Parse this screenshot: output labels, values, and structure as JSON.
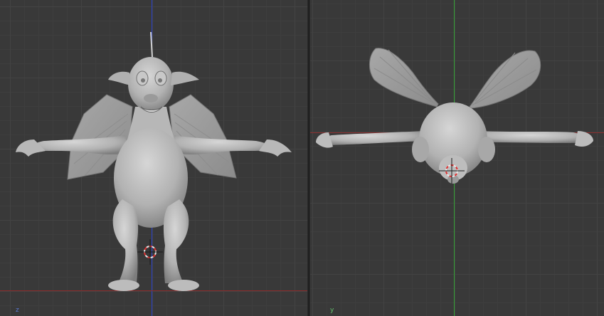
{
  "viewports": {
    "left": {
      "axis_label": "z",
      "axis_label_color": "#5b7bd6"
    },
    "right": {
      "axis_label": "y",
      "axis_label_color": "#63c36e"
    }
  },
  "colors": {
    "axis_vertical_left": "#2a41c8",
    "axis_horizontal_left": "#8a2c2c",
    "axis_vertical_right": "#33a033",
    "axis_horizontal_right": "#8a2c2c",
    "model_fill": "#b3b3b3",
    "model_shadow": "#8a8a8a",
    "cursor_red": "#e03030"
  },
  "icons": [
    "3d-cursor-icon",
    "3d-cursor-icon"
  ]
}
